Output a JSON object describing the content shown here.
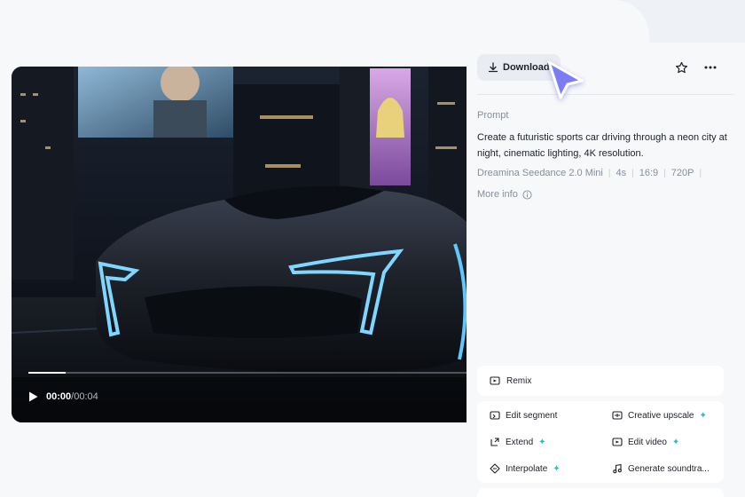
{
  "player": {
    "time_current": "00:00",
    "time_separator": "/",
    "time_total": "00:04",
    "progress_percent": 8.5
  },
  "toolbar": {
    "download_label": "Download",
    "favorite_icon": "star-icon",
    "more_icon": "more-horizontal-icon"
  },
  "details": {
    "prompt_label": "Prompt",
    "prompt_text": "Create a futuristic sports car driving through a neon city at night, cinematic lighting, 4K resolution.",
    "meta": [
      "Dreamina Seedance 2.0 Mini",
      "4s",
      "16:9",
      "720P"
    ],
    "more_info_label": "More info"
  },
  "actions": {
    "remix_label": "Remix",
    "tools": [
      {
        "label": "Edit segment",
        "icon": "edit-segment-icon",
        "spark": false
      },
      {
        "label": "Creative upscale",
        "icon": "upscale-icon",
        "spark": true
      },
      {
        "label": "Extend",
        "icon": "extend-icon",
        "spark": true
      },
      {
        "label": "Edit video",
        "icon": "edit-video-icon",
        "spark": true
      },
      {
        "label": "Interpolate",
        "icon": "interpolate-icon",
        "spark": true
      },
      {
        "label": "Generate soundtra...",
        "icon": "music-note-icon",
        "spark": false
      }
    ]
  },
  "colors": {
    "accent_spark": "#17c3c8",
    "cursor": "#7b7cf5",
    "background": "#eef1f5"
  }
}
